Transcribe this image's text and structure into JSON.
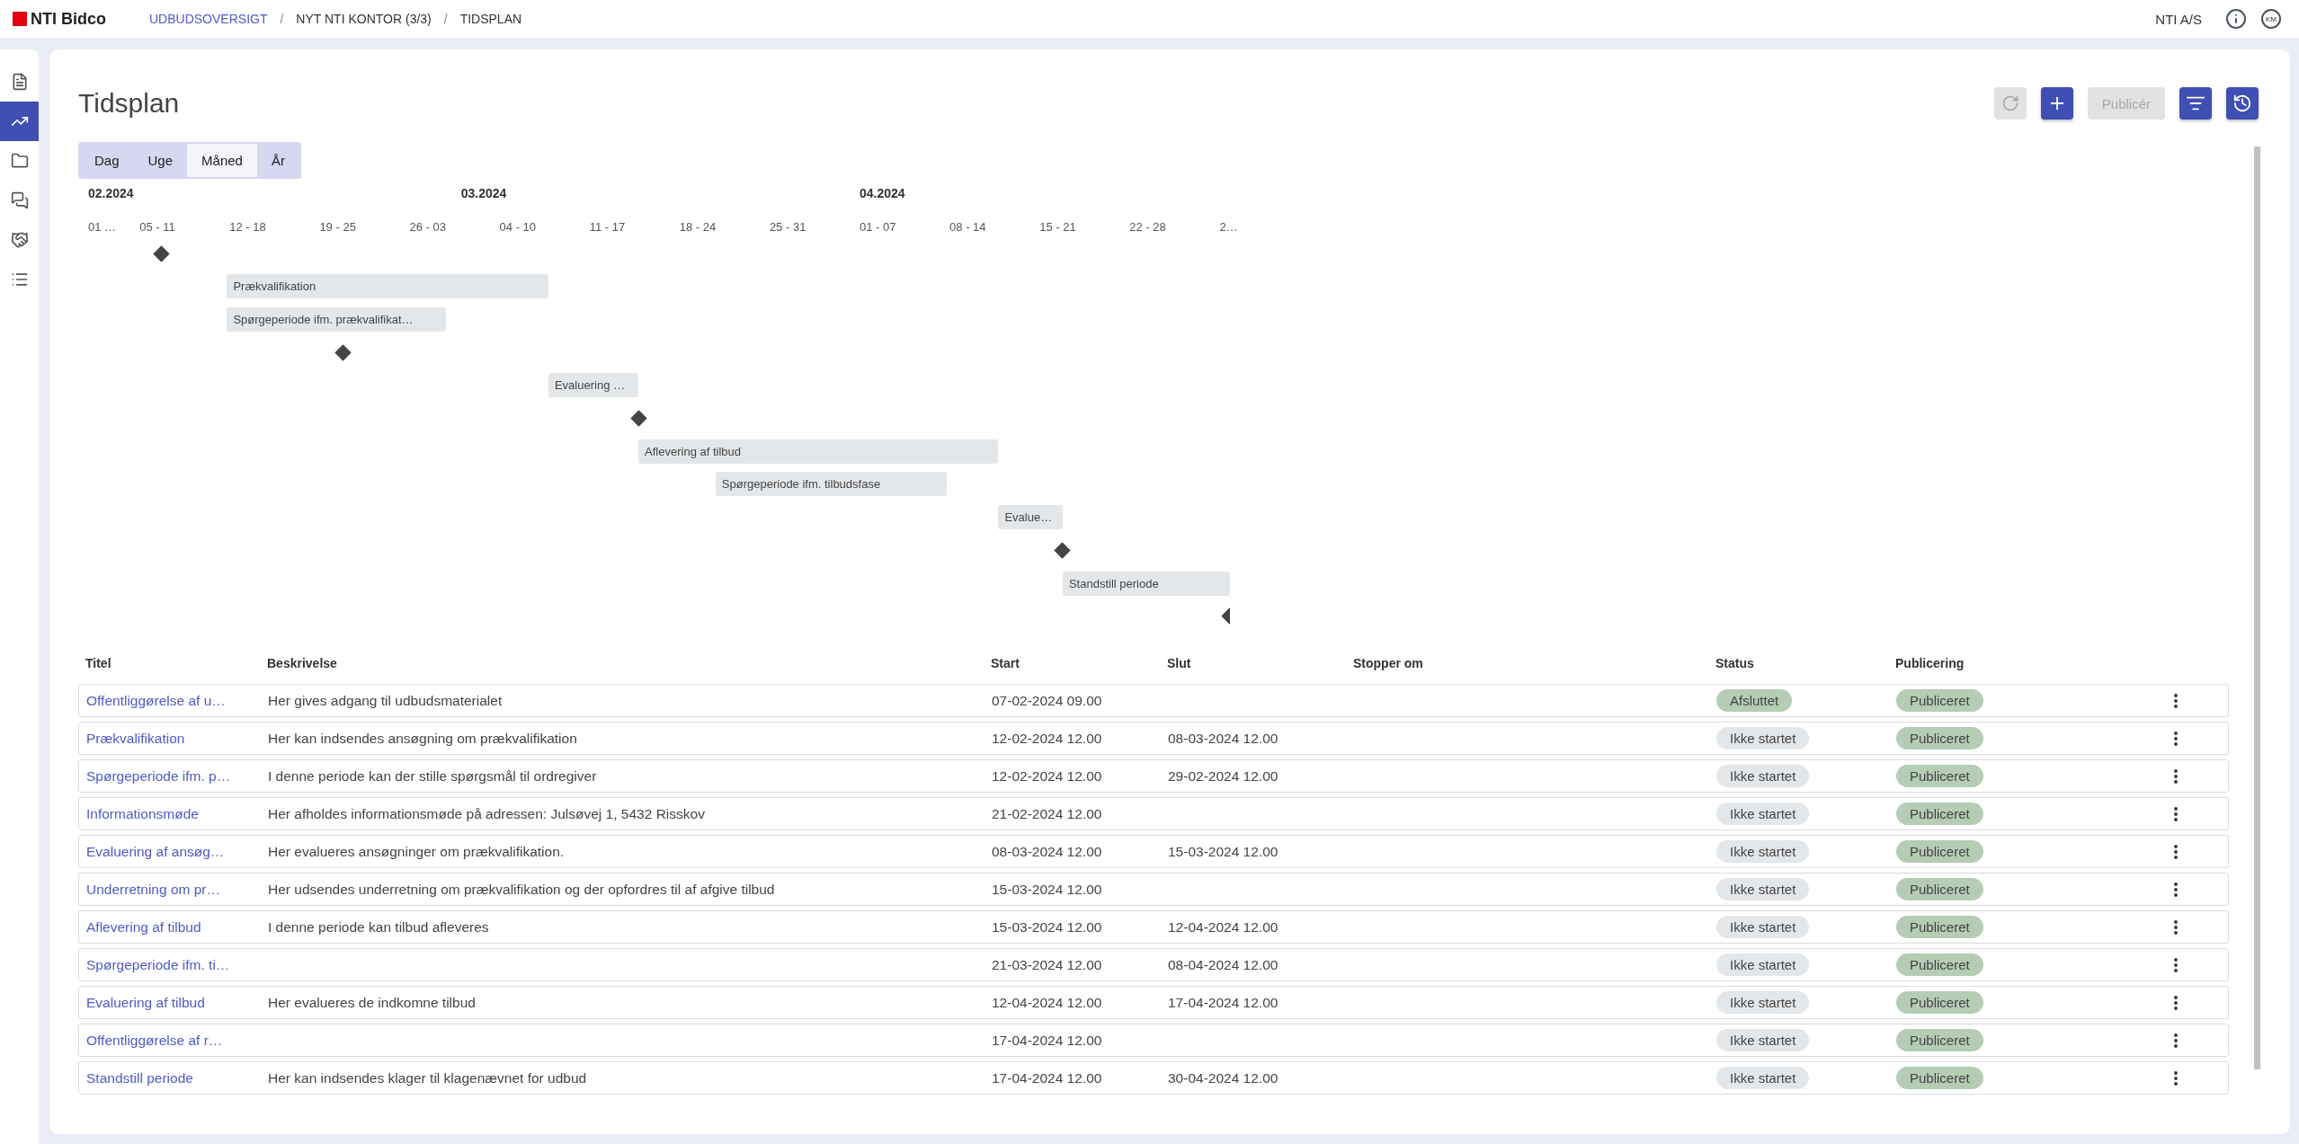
{
  "topbar": {
    "logo": "NTI Bidco",
    "breadcrumbs": [
      {
        "label": "UDBUDSOVERSIGT",
        "link": true
      },
      {
        "label": "NYT NTI KONTOR (3/3)",
        "link": false
      },
      {
        "label": "TIDSPLAN",
        "link": false
      }
    ],
    "separators": [
      "/",
      "/"
    ],
    "company": "NTI A/S",
    "avatar": "KM"
  },
  "sidebar": {
    "items": [
      {
        "kind": "document",
        "selected": false
      },
      {
        "kind": "chart",
        "selected": true
      },
      {
        "kind": "folder",
        "selected": false
      },
      {
        "kind": "chat",
        "selected": false
      },
      {
        "kind": "handshake",
        "selected": false
      },
      {
        "kind": "list",
        "selected": false
      }
    ]
  },
  "page": {
    "title": "Tidsplan",
    "actions": [
      {
        "kind": "refresh",
        "disabled": true
      },
      {
        "kind": "add",
        "disabled": false
      },
      {
        "kind": "text",
        "label": "Publicér",
        "disabled": true
      },
      {
        "kind": "filter",
        "disabled": false
      },
      {
        "kind": "history",
        "disabled": false
      }
    ]
  },
  "view_tabs": [
    {
      "label": "Dag",
      "selected": false
    },
    {
      "label": "Uge",
      "selected": false
    },
    {
      "label": "Måned",
      "selected": true
    },
    {
      "label": "År",
      "selected": false
    }
  ],
  "gantt": {
    "months": [
      "02.2024",
      "03.2024",
      "04.2024"
    ],
    "weeks": [
      "01 …",
      "05 - 11",
      "12 - 18",
      "19 - 25",
      "26 - 03",
      "04 - 10",
      "11 - 17",
      "18 - 24",
      "25 - 31",
      "01 - 07",
      "08 - 14",
      "15 - 21",
      "22 - 28",
      "2…"
    ],
    "items": [
      {
        "kind": "milestone"
      },
      {
        "kind": "bar",
        "label": "Prækvalifikation"
      },
      {
        "kind": "bar",
        "label": "Spørgeperiode ifm. prækvalifikat…"
      },
      {
        "kind": "milestone"
      },
      {
        "kind": "bar",
        "label": "Evaluering …"
      },
      {
        "kind": "milestone"
      },
      {
        "kind": "bar",
        "label": "Aflevering af tilbud"
      },
      {
        "kind": "bar",
        "label": "Spørgeperiode ifm. tilbudsfase"
      },
      {
        "kind": "bar",
        "label": "Evalue…"
      },
      {
        "kind": "milestone"
      },
      {
        "kind": "bar",
        "label": "Standstill periode"
      },
      {
        "kind": "milestone"
      }
    ]
  },
  "table": {
    "columns": [
      "Titel",
      "Beskrivelse",
      "Start",
      "Slut",
      "Stopper om",
      "Status",
      "Publicering"
    ],
    "rows": [
      {
        "title": "Offentliggørelse af u…",
        "description": "Her gives adgang til udbudsmaterialet",
        "start": "07-02-2024 09.00",
        "status": {
          "label": "Afsluttet",
          "kind": "done"
        },
        "publishing": {
          "label": "Publiceret",
          "kind": "published"
        }
      },
      {
        "title": "Prækvalifikation",
        "description": "Her kan indsendes ansøgning om prækvalifikation",
        "start": "12-02-2024 12.00",
        "end": "08-03-2024 12.00",
        "status": {
          "label": "Ikke startet",
          "kind": "pending"
        },
        "publishing": {
          "label": "Publiceret",
          "kind": "published"
        }
      },
      {
        "title": "Spørgeperiode ifm. p…",
        "description": "I denne periode kan der stille spørgsmål til ordregiver",
        "start": "12-02-2024 12.00",
        "end": "29-02-2024 12.00",
        "status": {
          "label": "Ikke startet",
          "kind": "pending"
        },
        "publishing": {
          "label": "Publiceret",
          "kind": "published"
        }
      },
      {
        "title": "Informationsmøde",
        "description": "Her afholdes informationsmøde på adressen: Julsøvej 1, 5432 Risskov",
        "start": "21-02-2024 12.00",
        "status": {
          "label": "Ikke startet",
          "kind": "pending"
        },
        "publishing": {
          "label": "Publiceret",
          "kind": "published"
        }
      },
      {
        "title": "Evaluering af ansøg…",
        "description": "Her evalueres ansøgninger om prækvalifikation.",
        "start": "08-03-2024 12.00",
        "end": "15-03-2024 12.00",
        "status": {
          "label": "Ikke startet",
          "kind": "pending"
        },
        "publishing": {
          "label": "Publiceret",
          "kind": "published"
        }
      },
      {
        "title": "Underretning om pr…",
        "description": "Her udsendes underretning om prækvalifikation og der opfordres til af afgive tilbud",
        "start": "15-03-2024 12.00",
        "status": {
          "label": "Ikke startet",
          "kind": "pending"
        },
        "publishing": {
          "label": "Publiceret",
          "kind": "published"
        }
      },
      {
        "title": "Aflevering af tilbud",
        "description": "I denne periode kan tilbud afleveres",
        "start": "15-03-2024 12.00",
        "end": "12-04-2024 12.00",
        "status": {
          "label": "Ikke startet",
          "kind": "pending"
        },
        "publishing": {
          "label": "Publiceret",
          "kind": "published"
        }
      },
      {
        "title": "Spørgeperiode ifm. ti…",
        "start": "21-03-2024 12.00",
        "end": "08-04-2024 12.00",
        "status": {
          "label": "Ikke startet",
          "kind": "pending"
        },
        "publishing": {
          "label": "Publiceret",
          "kind": "published"
        }
      },
      {
        "title": "Evaluering af tilbud",
        "description": "Her evalueres de indkomne tilbud",
        "start": "12-04-2024 12.00",
        "end": "17-04-2024 12.00",
        "status": {
          "label": "Ikke startet",
          "kind": "pending"
        },
        "publishing": {
          "label": "Publiceret",
          "kind": "published"
        }
      },
      {
        "title": "Offentliggørelse af r…",
        "start": "17-04-2024 12.00",
        "status": {
          "label": "Ikke startet",
          "kind": "pending"
        },
        "publishing": {
          "label": "Publiceret",
          "kind": "published"
        }
      },
      {
        "title": "Standstill periode",
        "description": "Her kan indsendes klager til klagenævnet for udbud",
        "start": "17-04-2024 12.00",
        "end": "30-04-2024 12.00",
        "status": {
          "label": "Ikke startet",
          "kind": "pending"
        },
        "publishing": {
          "label": "Publiceret",
          "kind": "published"
        }
      }
    ]
  }
}
